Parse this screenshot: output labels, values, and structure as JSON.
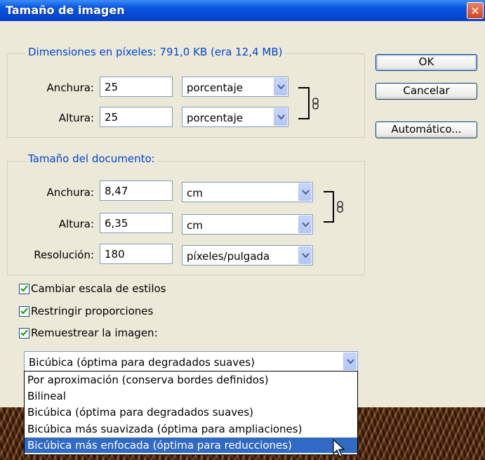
{
  "window": {
    "title": "Tamaño de imagen",
    "close_glyph": "✕"
  },
  "pixel_dimensions": {
    "legend": "Dimensiones en píxeles: 791,0 KB (era 12,4 MB)",
    "width_label": "Anchura:",
    "width_value": "25",
    "width_unit": "porcentaje",
    "height_label": "Altura:",
    "height_value": "25",
    "height_unit": "porcentaje"
  },
  "document_size": {
    "legend": "Tamaño del documento:",
    "width_label": "Anchura:",
    "width_value": "8,47",
    "width_unit": "cm",
    "height_label": "Altura:",
    "height_value": "6,35",
    "height_unit": "cm",
    "resolution_label": "Resolución:",
    "resolution_value": "180",
    "resolution_unit": "píxeles/pulgada"
  },
  "buttons": {
    "ok": "OK",
    "cancel": "Cancelar",
    "auto": "Automático..."
  },
  "checkboxes": {
    "scale_styles": {
      "label": "Cambiar escala de estilos",
      "checked": true
    },
    "constrain": {
      "label": "Restringir proporciones",
      "checked": true
    },
    "resample": {
      "label": "Remuestrear la imagen:",
      "checked": true
    }
  },
  "resample_method": {
    "selected": "Bicúbica (óptima para degradados suaves)",
    "options": [
      "Por aproximación (conserva bordes definidos)",
      "Bilineal",
      "Bicúbica (óptima para degradados suaves)",
      "Bicúbica más suavizada (óptima para ampliaciones)",
      "Bicúbica más enfocada (óptima para reducciones)"
    ],
    "highlighted_option": "Bicúbica más enfocada (óptima para reducciones)"
  },
  "icons": {
    "link": "chain-link-icon",
    "arrow": "chevron-down-icon",
    "check": "checkmark-icon",
    "cursor": "mouse-pointer-icon"
  },
  "colors": {
    "titlebar": "#0549d4",
    "legend_text": "#0046d5",
    "selection": "#316ac5",
    "dialog_bg": "#ece9d8"
  }
}
